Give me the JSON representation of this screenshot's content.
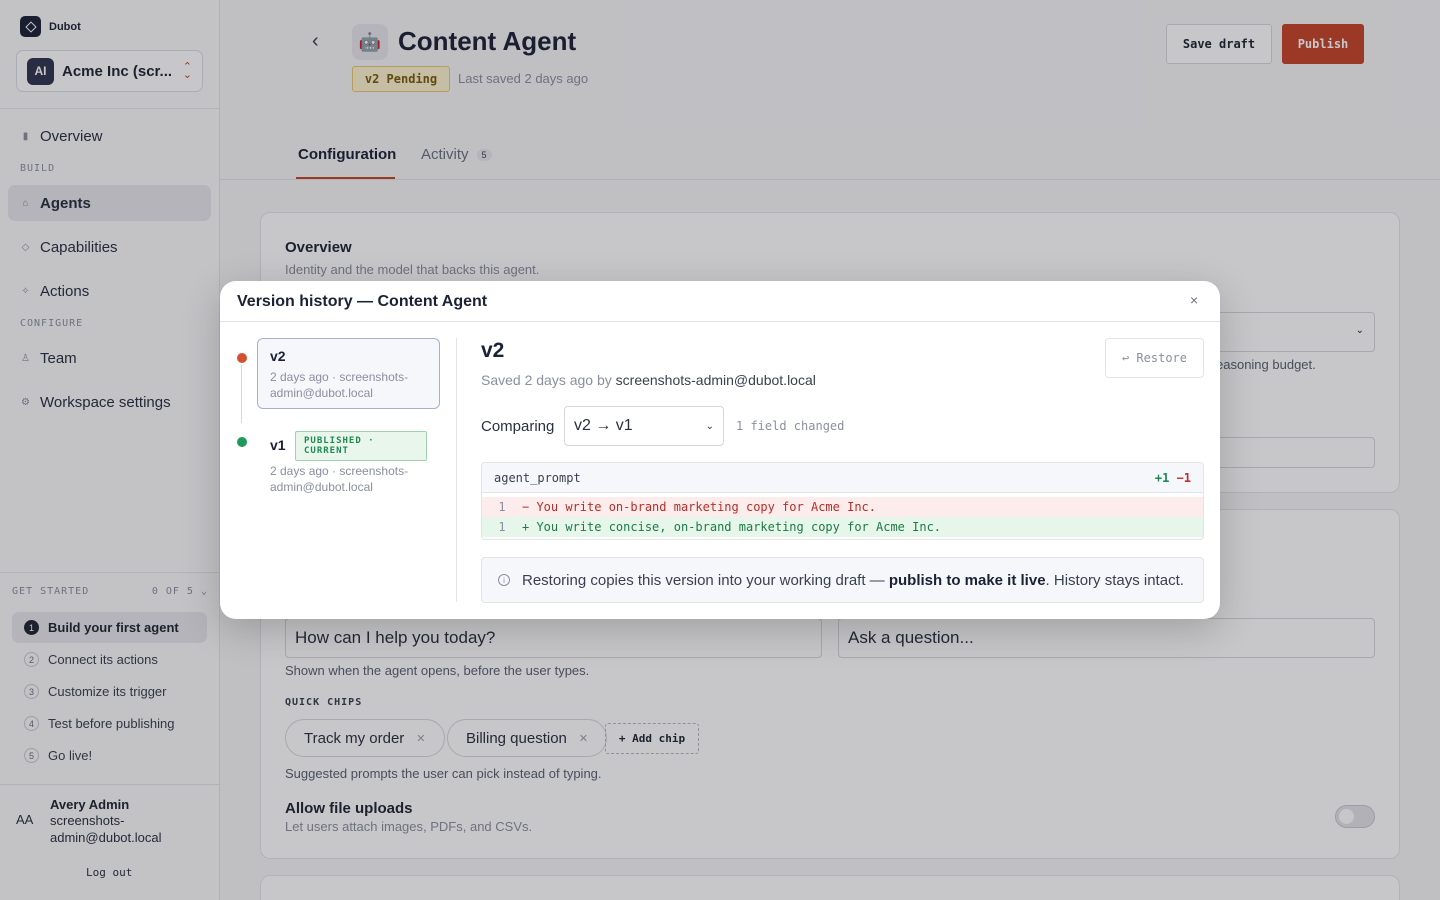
{
  "sidebar": {
    "brand": "Dubot",
    "workspace": {
      "avatar": "AI",
      "name": "Acme Inc (scr..."
    },
    "nav": {
      "overview": "Overview",
      "build_heading": "BUILD",
      "agents": "Agents",
      "capabilities": "Capabilities",
      "actions": "Actions",
      "configure_heading": "CONFIGURE",
      "team": "Team",
      "workspace_settings": "Workspace settings"
    },
    "get_started": {
      "heading": "GET STARTED",
      "progress": "0 OF 5",
      "steps": [
        {
          "num": "1",
          "label": "Build your first agent"
        },
        {
          "num": "2",
          "label": "Connect its actions"
        },
        {
          "num": "3",
          "label": "Customize its trigger"
        },
        {
          "num": "4",
          "label": "Test before publishing"
        },
        {
          "num": "5",
          "label": "Go live!"
        }
      ]
    },
    "user": {
      "avatar": "AA",
      "name": "Avery Admin",
      "email": "screenshots-admin@dubot.local",
      "logout": "Log out"
    }
  },
  "header": {
    "icon": "robot-emoji",
    "icon_glyph": "🤖",
    "title": "Content Agent",
    "badge": "v2 Pending",
    "saved": "Last saved 2 days ago",
    "save_draft": "Save draft",
    "publish": "Publish"
  },
  "tabs": {
    "configuration": "Configuration",
    "activity": "Activity",
    "activity_count": "5"
  },
  "overview": {
    "title": "Overview",
    "subtitle": "Identity and the model that backs this agent.",
    "model_hint_fragment": "easoning budget."
  },
  "welcome": {
    "greeting_value": "How can I help you today?",
    "placeholder_value": "Ask a question...",
    "greeting_hint": "Shown when the agent opens, before the user types.",
    "quick_chips_heading": "QUICK CHIPS",
    "chips": [
      "Track my order",
      "Billing question"
    ],
    "add_chip": "+ Add chip",
    "chips_hint": "Suggested prompts the user can pick instead of typing."
  },
  "uploads": {
    "title": "Allow file uploads",
    "subtitle": "Let users attach images, PDFs, and CSVs.",
    "enabled": false
  },
  "modal": {
    "title": "Version history — Content Agent",
    "close_glyph": "×",
    "versions": [
      {
        "name": "v2",
        "meta": "2 days ago · screenshots-admin@dubot.local",
        "status_color": "#d4502e"
      },
      {
        "name": "v1",
        "badge": "PUBLISHED · CURRENT",
        "meta": "2 days ago · screenshots-admin@dubot.local",
        "status_color": "#1e9a5a"
      }
    ],
    "detail": {
      "version": "v2",
      "saved_prefix": "Saved 2 days ago by",
      "saved_by": "screenshots-admin@dubot.local",
      "restore": "↩ Restore",
      "comparing_label": "Comparing",
      "comparing_value": "v2 → v1",
      "changed_count": "1 field changed",
      "diff": {
        "field": "agent_prompt",
        "added": "+1",
        "removed": "−1",
        "removed_line": {
          "num": "1",
          "text": "− You write on-brand marketing copy for Acme Inc."
        },
        "added_line": {
          "num": "1",
          "text": "+ You write concise, on-brand marketing copy for Acme Inc."
        }
      },
      "info_prefix": "Restoring copies this version into your working draft — ",
      "info_bold": "publish to make it live",
      "info_suffix": ". History stays intact."
    }
  },
  "colors": {
    "accent": "#c5432a",
    "published": "#1e9a5a",
    "pending": "#fdf3cf"
  }
}
